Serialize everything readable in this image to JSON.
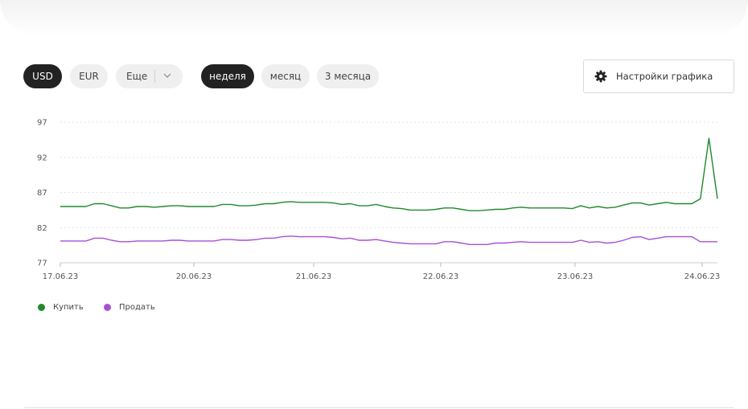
{
  "currency_tabs": [
    {
      "label": "USD",
      "active": true
    },
    {
      "label": "EUR",
      "active": false
    }
  ],
  "more_label": "Еще",
  "period_tabs": [
    {
      "label": "неделя",
      "active": true
    },
    {
      "label": "месяц",
      "active": false
    },
    {
      "label": "3 месяца",
      "active": false
    }
  ],
  "settings_label": "Настройки графика",
  "legend": [
    {
      "label": "Купить",
      "color": "#21892e"
    },
    {
      "label": "Продать",
      "color": "#a94fd6"
    }
  ],
  "chart_data": {
    "type": "line",
    "title": "",
    "xlabel": "",
    "ylabel": "",
    "ylim": [
      77,
      97
    ],
    "yticks": [
      97,
      92,
      87,
      82,
      77
    ],
    "xticks": [
      "17.06.23",
      "20.06.23",
      "21.06.23",
      "22.06.23",
      "23.06.23",
      "24.06.23"
    ],
    "grid": true,
    "legend_position": "bottom-left",
    "series": [
      {
        "name": "Купить",
        "color": "#21892e",
        "values": [
          85.0,
          85.0,
          85.0,
          85.0,
          85.4,
          85.4,
          85.1,
          84.8,
          84.8,
          85.0,
          85.0,
          84.9,
          85.0,
          85.1,
          85.1,
          85.0,
          85.0,
          85.0,
          85.0,
          85.3,
          85.3,
          85.1,
          85.1,
          85.2,
          85.4,
          85.4,
          85.6,
          85.7,
          85.6,
          85.6,
          85.6,
          85.6,
          85.5,
          85.3,
          85.4,
          85.1,
          85.1,
          85.3,
          85.0,
          84.8,
          84.7,
          84.5,
          84.5,
          84.5,
          84.6,
          84.8,
          84.8,
          84.6,
          84.4,
          84.4,
          84.5,
          84.6,
          84.6,
          84.8,
          84.9,
          84.8,
          84.8,
          84.8,
          84.8,
          84.8,
          84.7,
          85.1,
          84.8,
          85.0,
          84.8,
          84.9,
          85.2,
          85.5,
          85.5,
          85.2,
          85.4,
          85.6,
          85.4,
          85.4,
          85.4,
          86.1,
          94.7,
          86.1
        ]
      },
      {
        "name": "Продать",
        "color": "#a94fd6",
        "values": [
          80.1,
          80.1,
          80.1,
          80.1,
          80.5,
          80.5,
          80.2,
          80.0,
          80.0,
          80.1,
          80.1,
          80.1,
          80.1,
          80.2,
          80.2,
          80.1,
          80.1,
          80.1,
          80.1,
          80.3,
          80.3,
          80.2,
          80.2,
          80.3,
          80.5,
          80.5,
          80.7,
          80.8,
          80.7,
          80.7,
          80.7,
          80.7,
          80.6,
          80.4,
          80.5,
          80.2,
          80.2,
          80.3,
          80.1,
          79.9,
          79.8,
          79.7,
          79.7,
          79.7,
          79.7,
          80.0,
          80.0,
          79.8,
          79.6,
          79.6,
          79.6,
          79.8,
          79.8,
          79.9,
          80.0,
          79.9,
          79.9,
          79.9,
          79.9,
          79.9,
          79.9,
          80.2,
          79.9,
          80.0,
          79.8,
          79.9,
          80.2,
          80.6,
          80.7,
          80.3,
          80.5,
          80.7,
          80.7,
          80.7,
          80.7,
          80.0,
          80.0,
          80.0
        ]
      }
    ]
  }
}
